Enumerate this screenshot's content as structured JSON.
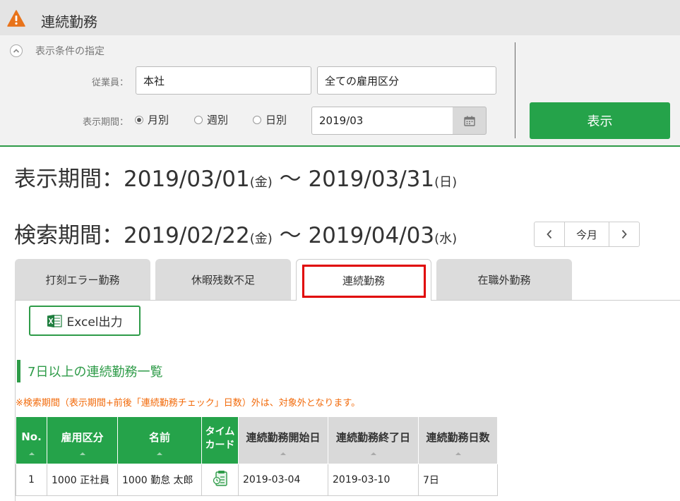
{
  "header": {
    "title": "連続勤務"
  },
  "conditions": {
    "title": "表示条件の指定",
    "employee_label": "従業員：",
    "employee_value": "本社",
    "employment_type_value": "全ての雇用区分",
    "period_label": "表示期間：",
    "period_options": [
      {
        "label": "月別",
        "selected": true
      },
      {
        "label": "週別",
        "selected": false
      },
      {
        "label": "日別",
        "selected": false
      }
    ],
    "month_value": "2019/03",
    "show_button": "表示"
  },
  "display_period": {
    "label": "表示期間：",
    "start": "2019/03/01",
    "start_dow": "(金)",
    "sep": " ～ ",
    "end": "2019/03/31",
    "end_dow": "(日)"
  },
  "search_period": {
    "label": "検索期間：",
    "start": "2019/02/22",
    "start_dow": "(金)",
    "sep": " ～ ",
    "end": "2019/04/03",
    "end_dow": "(水)"
  },
  "nav": {
    "today": "今月"
  },
  "tabs": [
    {
      "label": "打刻エラー勤務",
      "active": false
    },
    {
      "label": "休暇残数不足",
      "active": false
    },
    {
      "label": "連続勤務",
      "active": true
    },
    {
      "label": "在職外勤務",
      "active": false
    }
  ],
  "excel_button": "Excel出力",
  "section_title": "7日以上の連続勤務一覧",
  "notice": "※検索期間（表示期間+前後「連続勤務チェック」日数）外は、対象外となります。",
  "table": {
    "headers": {
      "no": "No.",
      "employment_type": "雇用区分",
      "name": "名前",
      "timecard_1": "タイム",
      "timecard_2": "カード",
      "start_date": "連続勤務開始日",
      "end_date": "連続勤務終了日",
      "days": "連続勤務日数"
    },
    "rows": [
      {
        "no": "1",
        "employment_type": "1000 正社員",
        "name": "1000 勤怠 太郎",
        "start_date": "2019-03-04",
        "end_date": "2019-03-10",
        "days": "7日"
      }
    ]
  },
  "colors": {
    "green": "#25a34a",
    "highlight_red": "#e00000",
    "notice_orange": "#f26a0a",
    "warning_orange": "#e8731a"
  },
  "icons": {
    "title": "warning-icon",
    "toggle": "chevron-up-icon",
    "calendar": "calendar-icon",
    "prev": "chevron-left-icon",
    "next": "chevron-right-icon",
    "excel": "excel-icon",
    "timecard": "timecard-icon"
  }
}
